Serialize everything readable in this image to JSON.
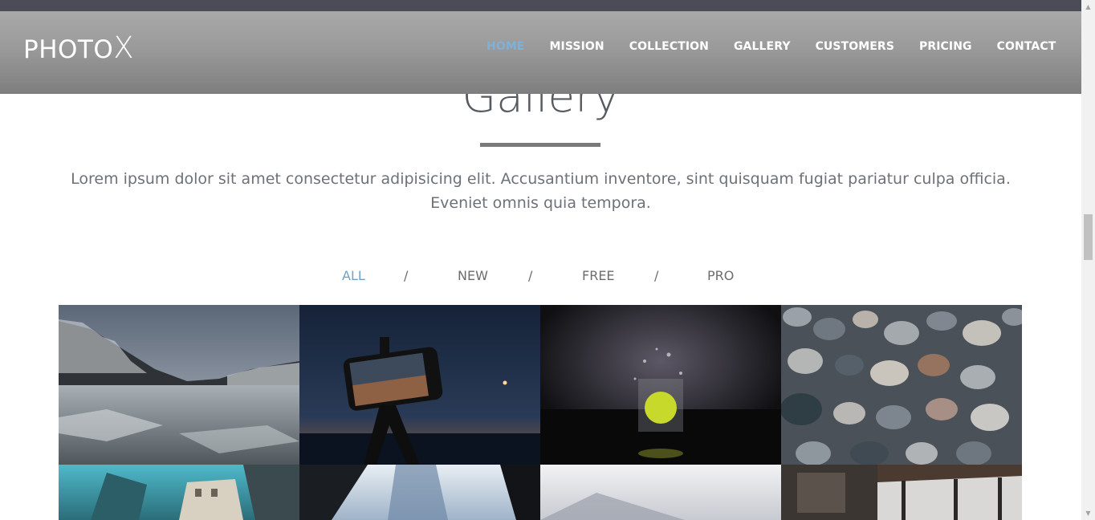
{
  "header": {
    "brand": {
      "main": "PHOTO",
      "x": "X"
    },
    "nav": [
      {
        "label": "HOME",
        "active": true
      },
      {
        "label": "MISSION",
        "active": false
      },
      {
        "label": "COLLECTION",
        "active": false
      },
      {
        "label": "GALLERY",
        "active": false
      },
      {
        "label": "CUSTOMERS",
        "active": false
      },
      {
        "label": "PRICING",
        "active": false
      },
      {
        "label": "CONTACT",
        "active": false
      }
    ]
  },
  "gallery": {
    "title": "Gallery",
    "intro_line1": "Lorem ipsum dolor sit amet consectetur adipisicing elit. Accusantium inventore, sint quisquam fugiat pariatur culpa officia.",
    "intro_line2": "Eveniet omnis quia tempora.",
    "filters": [
      "ALL",
      "NEW",
      "FREE",
      "PRO"
    ],
    "active_filter": "ALL",
    "separator": "/",
    "images": [
      "lake-mountains-image",
      "phone-tripod-image",
      "lime-glass-splash-image",
      "pebbles-image",
      "city-buildings-image",
      "skyscraper-fog-image",
      "misty-building-image",
      "train-station-snow-image"
    ]
  },
  "colors": {
    "accent": "#6fa2c8",
    "nav_text": "#ffffff",
    "title": "#565a61",
    "body_text": "#6d7178"
  },
  "icons": {
    "scroll_up": "triangle-up",
    "scroll_down": "triangle-down"
  }
}
